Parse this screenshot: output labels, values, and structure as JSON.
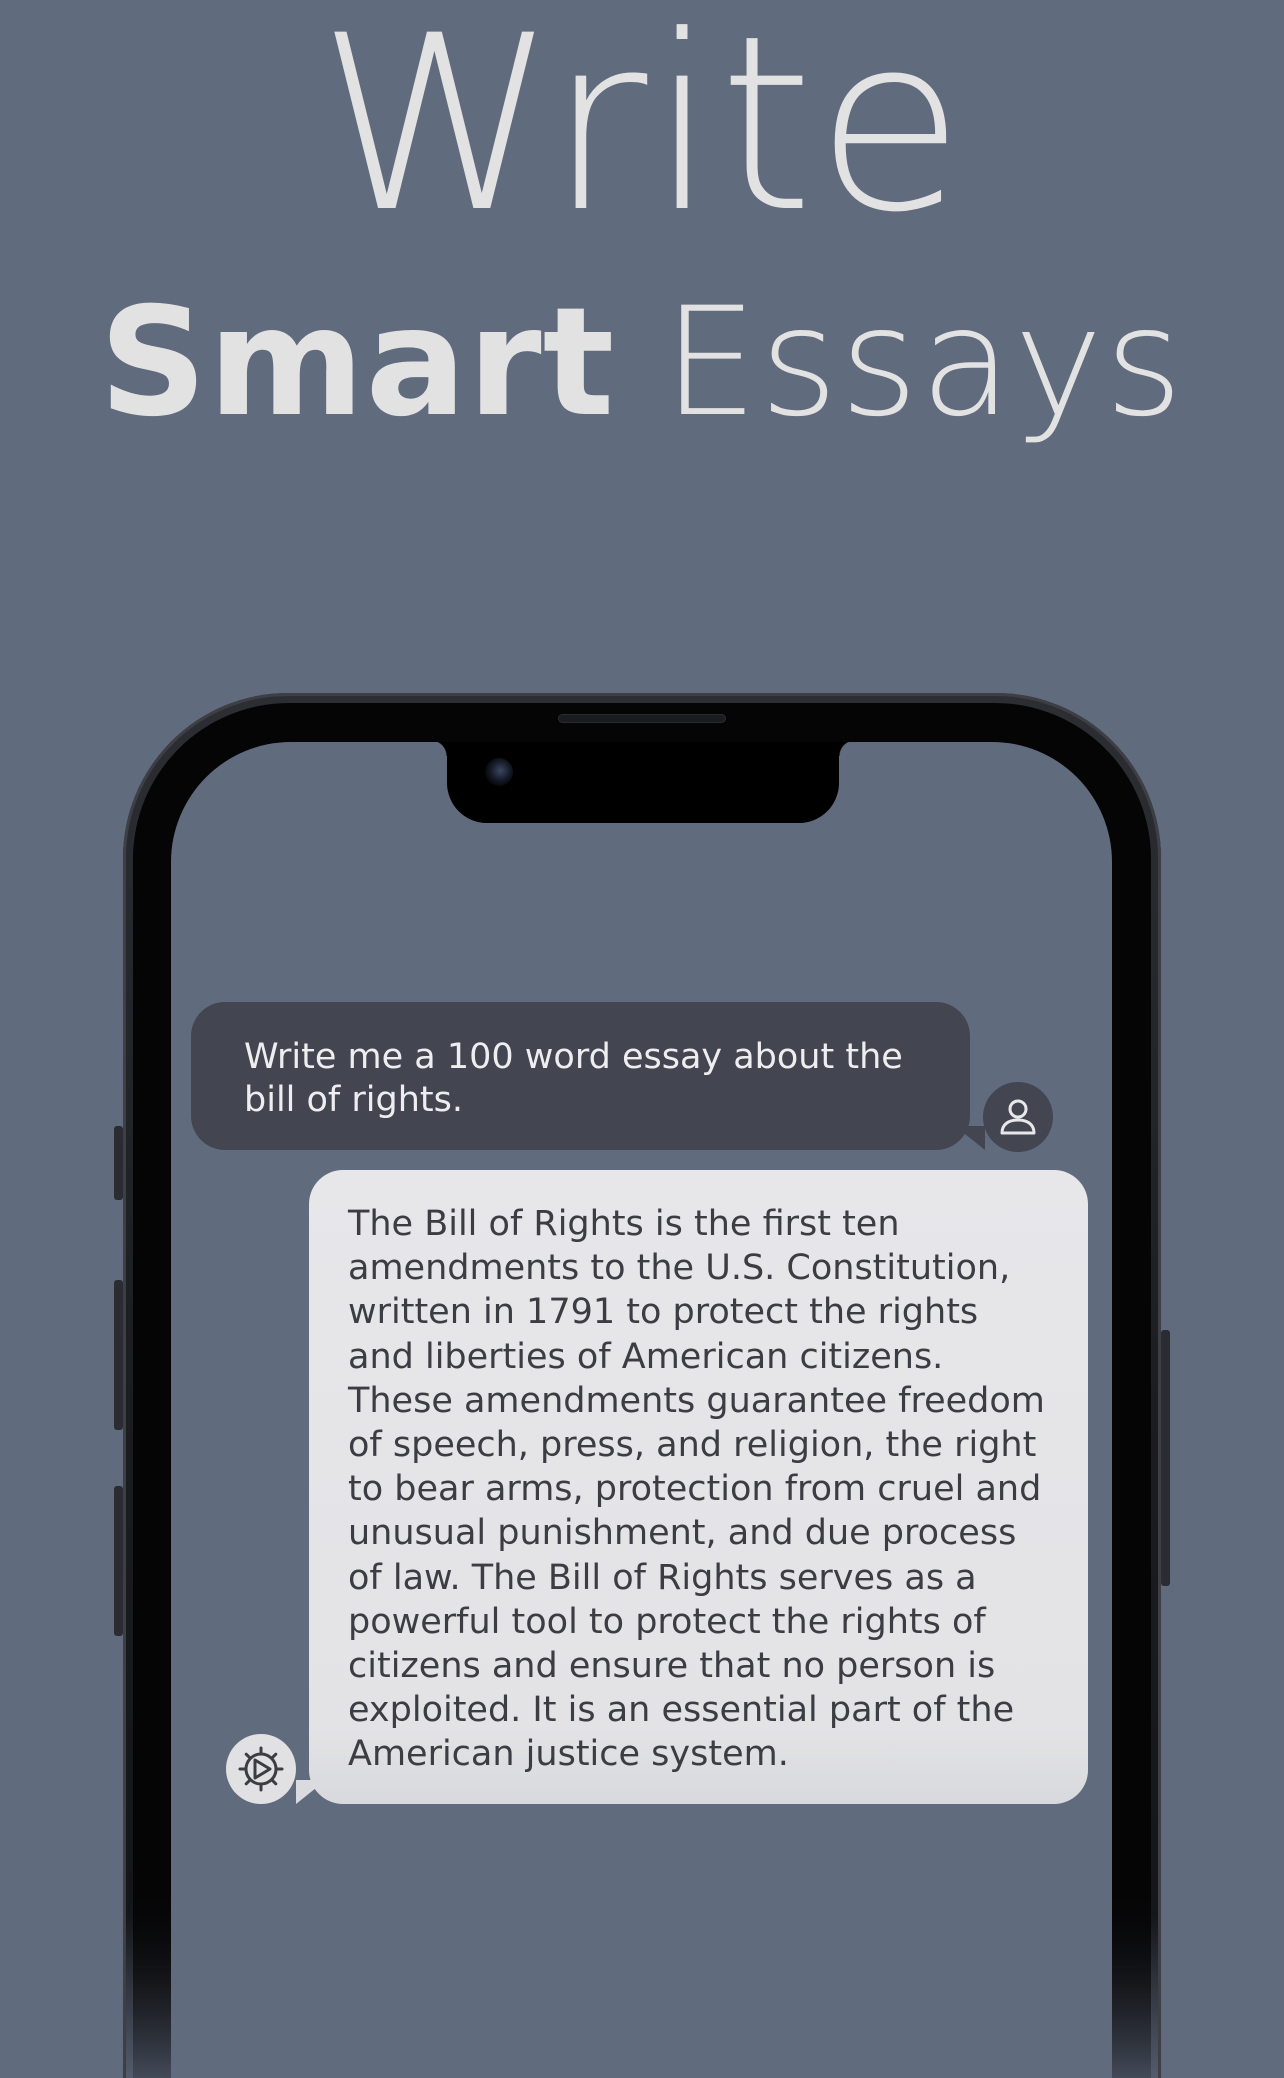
{
  "headline": {
    "line1": "Write",
    "line2_bold": "Smart",
    "line2_light": "Essays"
  },
  "chat": {
    "user_message": "Write me a 100 word essay about the bill of rights.",
    "assistant_message": "The Bill of Rights is the first ten amendments to the U.S. Constitution, written in 1791 to protect the rights and liberties of American citizens. These amendments guarantee freedom of speech, press, and religion, the right to bear arms, protection from cruel and unusual punishment, and due process of law. The Bill of Rights serves as a powerful tool to protect the rights of citizens and ensure that no person is exploited. It is an essential part of the American justice system.",
    "user_avatar_icon": "person-icon",
    "assistant_avatar_icon": "gear-icon"
  },
  "colors": {
    "background": "#606b7e",
    "headline_text": "#e2e2e2",
    "user_bubble": "#434551",
    "assistant_bubble": "#e4e4e7",
    "phone_bezel": "#050506"
  }
}
